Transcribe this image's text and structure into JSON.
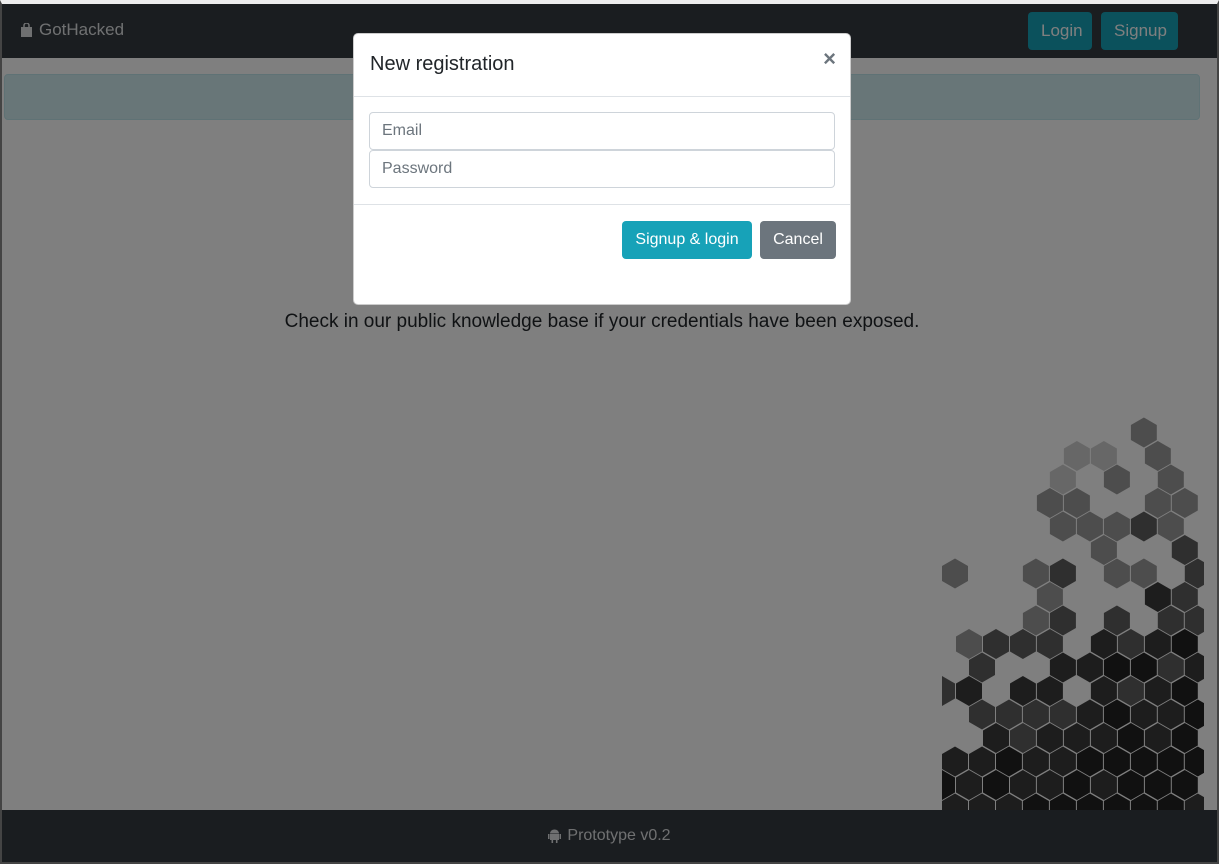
{
  "navbar": {
    "brand": "GotHacked",
    "brand_icon": "shopping-bag-icon",
    "login_label": "Login",
    "signup_label": "Signup"
  },
  "main": {
    "tagline": "Check in our public knowledge base if your credentials have been exposed."
  },
  "footer": {
    "icon": "android-icon",
    "text": "Prototype v0.2"
  },
  "modal": {
    "title": "New registration",
    "close_label": "×",
    "email_placeholder": "Email",
    "password_placeholder": "Password",
    "submit_label": "Signup & login",
    "cancel_label": "Cancel"
  },
  "colors": {
    "navbar": "#343a40",
    "primary": "#17a2b8",
    "secondary": "#6c757d"
  }
}
